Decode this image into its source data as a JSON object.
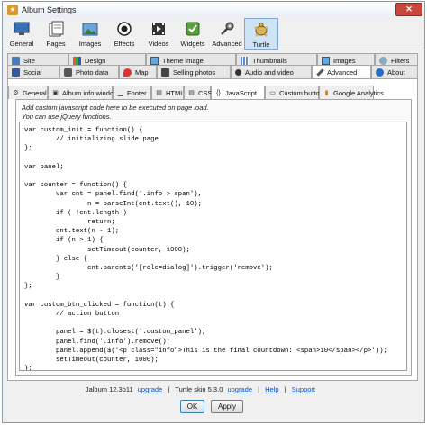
{
  "window": {
    "title": "Album Settings",
    "close_glyph": "✕"
  },
  "toolbar": {
    "items": [
      {
        "label": "General",
        "icon": "general-icon"
      },
      {
        "label": "Pages",
        "icon": "pages-icon"
      },
      {
        "label": "Images",
        "icon": "images-icon"
      },
      {
        "label": "Effects",
        "icon": "effects-icon"
      },
      {
        "label": "Videos",
        "icon": "videos-icon"
      },
      {
        "label": "Widgets",
        "icon": "widgets-icon"
      },
      {
        "label": "Advanced",
        "icon": "advanced-icon"
      },
      {
        "label": "Turtle",
        "icon": "turtle-icon",
        "active": true
      }
    ]
  },
  "tabs_row1": [
    {
      "label": "Site"
    },
    {
      "label": "Design"
    },
    {
      "label": "Theme image"
    },
    {
      "label": "Thumbnails"
    },
    {
      "label": "Images"
    },
    {
      "label": "Filters"
    }
  ],
  "tabs_row2": [
    {
      "label": "Social"
    },
    {
      "label": "Photo data"
    },
    {
      "label": "Map"
    },
    {
      "label": "Selling photos"
    },
    {
      "label": "Audio and video"
    },
    {
      "label": "Advanced",
      "selected": true
    },
    {
      "label": "About"
    }
  ],
  "subtabs": [
    {
      "label": "General"
    },
    {
      "label": "Album info window"
    },
    {
      "label": "Footer"
    },
    {
      "label": "HTML"
    },
    {
      "label": "CSS"
    },
    {
      "label": "JavaScript",
      "selected": true
    },
    {
      "label": "Custom button"
    },
    {
      "label": "Google Analytics"
    }
  ],
  "hint_line1": "Add custom javascript code here to be executed on page load.",
  "hint_line2": "You can use jQuery functions.",
  "code": "var custom_init = function() {\n        // initializing slide page\n};\n\nvar panel;\n\nvar counter = function() {\n        var cnt = panel.find('.info > span'),\n                n = parseInt(cnt.text(), 10);\n        if ( !cnt.length )\n                return;\n        cnt.text(n - 1);\n        if (n > 1) {\n                setTimeout(counter, 1000);\n        } else {\n                cnt.parents('[role=dialog]').trigger('remove');\n        }\n};\n\nvar custom_btn_clicked = function(t) {\n        // action button\n\n        panel = $(t).closest('.custom_panel');\n        panel.find('.info').remove();\n        panel.append($('<p class=\"info\">This is the final countdown: <span>10</span></p>'));\n        setTimeout(counter, 1000);\n};",
  "status": {
    "version": "Jalbum 12.3b11",
    "upgrade1": "upgrade",
    "skin": "Turtle skin 5.3.0",
    "upgrade2": "upgrade",
    "help": "Help",
    "support": "Support",
    "separator": "|"
  },
  "buttons": {
    "ok": "OK",
    "apply": "Apply"
  }
}
